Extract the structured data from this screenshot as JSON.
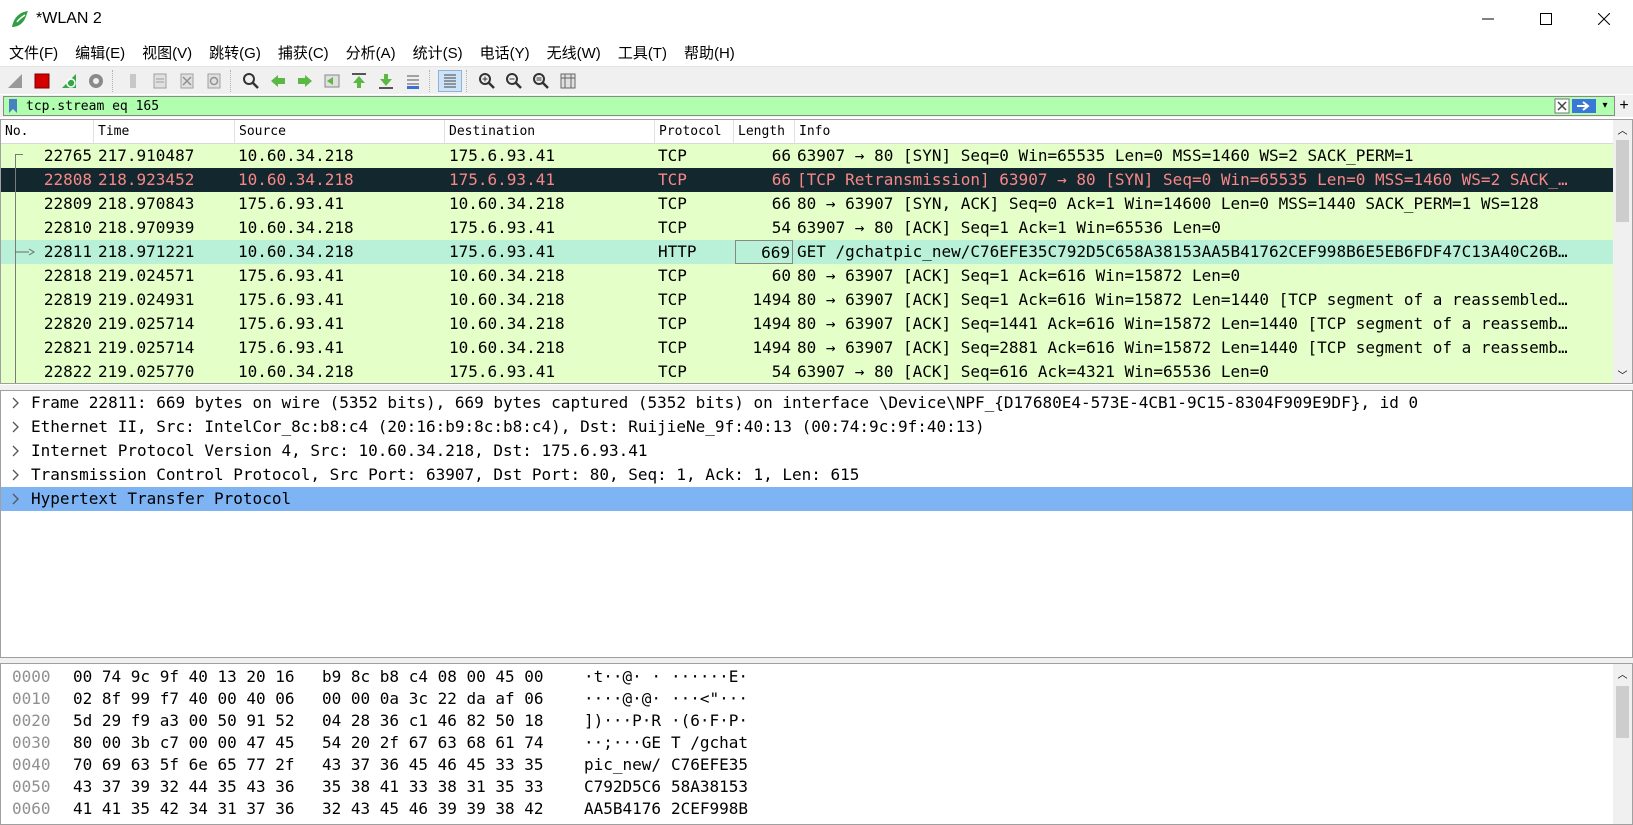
{
  "window": {
    "title": "*WLAN 2",
    "controls": [
      "minimize",
      "maximize",
      "close"
    ]
  },
  "menu": [
    "文件(F)",
    "编辑(E)",
    "视图(V)",
    "跳转(G)",
    "捕获(C)",
    "分析(A)",
    "统计(S)",
    "电话(Y)",
    "无线(W)",
    "工具(T)",
    "帮助(H)"
  ],
  "toolbar_icons": [
    "shark-fin-start-icon",
    "stop-capture-icon",
    "restart-capture-icon",
    "capture-options-icon",
    "open-file-icon",
    "save-file-icon",
    "close-file-icon",
    "reload-file-icon",
    "find-packet-icon",
    "go-back-icon",
    "go-forward-icon",
    "go-to-packet-icon",
    "go-first-icon",
    "go-last-icon",
    "autoscroll-icon",
    "colorize-icon",
    "zoom-in-icon",
    "zoom-out-icon",
    "zoom-normal-icon",
    "resize-columns-icon"
  ],
  "filter": {
    "value": "tcp.stream eq 165",
    "bg_color": "#afffaf"
  },
  "packet_list": {
    "columns": [
      "No.",
      "Time",
      "Source",
      "Destination",
      "Protocol",
      "Length",
      "Info"
    ],
    "rows": [
      {
        "no": "22765",
        "time": "217.910487",
        "src": "10.60.34.218",
        "dst": "175.6.93.41",
        "proto": "TCP",
        "len": "66",
        "info": "63907 → 80 [SYN] Seq=0 Win=65535 Len=0 MSS=1460 WS=2 SACK_PERM=1",
        "style": "row-green"
      },
      {
        "no": "22808",
        "time": "218.923452",
        "src": "10.60.34.218",
        "dst": "175.6.93.41",
        "proto": "TCP",
        "len": "66",
        "info": "[TCP Retransmission] 63907 → 80 [SYN] Seq=0 Win=65535 Len=0 MSS=1460 WS=2 SACK_…",
        "style": "row-black"
      },
      {
        "no": "22809",
        "time": "218.970843",
        "src": "175.6.93.41",
        "dst": "10.60.34.218",
        "proto": "TCP",
        "len": "66",
        "info": "80 → 63907 [SYN, ACK] Seq=0 Ack=1 Win=14600 Len=0 MSS=1440 SACK_PERM=1 WS=128",
        "style": "row-green"
      },
      {
        "no": "22810",
        "time": "218.970939",
        "src": "10.60.34.218",
        "dst": "175.6.93.41",
        "proto": "TCP",
        "len": "54",
        "info": "63907 → 80 [ACK] Seq=1 Ack=1 Win=65536 Len=0",
        "style": "row-green"
      },
      {
        "no": "22811",
        "time": "218.971221",
        "src": "10.60.34.218",
        "dst": "175.6.93.41",
        "proto": "HTTP",
        "len": "669",
        "info": "GET /gchatpic_new/C76EFE35C792D5C658A38153AA5B41762CEF998B6E5EB6FDF47C13A40C26B…",
        "style": "row-sel"
      },
      {
        "no": "22818",
        "time": "219.024571",
        "src": "175.6.93.41",
        "dst": "10.60.34.218",
        "proto": "TCP",
        "len": "60",
        "info": "80 → 63907 [ACK] Seq=1 Ack=616 Win=15872 Len=0",
        "style": "row-green"
      },
      {
        "no": "22819",
        "time": "219.024931",
        "src": "175.6.93.41",
        "dst": "10.60.34.218",
        "proto": "TCP",
        "len": "1494",
        "info": "80 → 63907 [ACK] Seq=1 Ack=616 Win=15872 Len=1440 [TCP segment of a reassembled…",
        "style": "row-green"
      },
      {
        "no": "22820",
        "time": "219.025714",
        "src": "175.6.93.41",
        "dst": "10.60.34.218",
        "proto": "TCP",
        "len": "1494",
        "info": "80 → 63907 [ACK] Seq=1441 Ack=616 Win=15872 Len=1440 [TCP segment of a reassemb…",
        "style": "row-green"
      },
      {
        "no": "22821",
        "time": "219.025714",
        "src": "175.6.93.41",
        "dst": "10.60.34.218",
        "proto": "TCP",
        "len": "1494",
        "info": "80 → 63907 [ACK] Seq=2881 Ack=616 Win=15872 Len=1440 [TCP segment of a reassemb…",
        "style": "row-green"
      },
      {
        "no": "22822",
        "time": "219.025770",
        "src": "10.60.34.218",
        "dst": "175.6.93.41",
        "proto": "TCP",
        "len": "54",
        "info": "63907 → 80 [ACK] Seq=616 Ack=4321 Win=65536 Len=0",
        "style": "row-green"
      }
    ]
  },
  "details": [
    {
      "text": "Frame 22811: 669 bytes on wire (5352 bits), 669 bytes captured (5352 bits) on interface \\Device\\NPF_{D17680E4-573E-4CB1-9C15-8304F909E9DF}, id 0",
      "selected": false
    },
    {
      "text": "Ethernet II, Src: IntelCor_8c:b8:c4 (20:16:b9:8c:b8:c4), Dst: RuijieNe_9f:40:13 (00:74:9c:9f:40:13)",
      "selected": false
    },
    {
      "text": "Internet Protocol Version 4, Src: 10.60.34.218, Dst: 175.6.93.41",
      "selected": false
    },
    {
      "text": "Transmission Control Protocol, Src Port: 63907, Dst Port: 80, Seq: 1, Ack: 1, Len: 615",
      "selected": false
    },
    {
      "text": "Hypertext Transfer Protocol",
      "selected": true
    }
  ],
  "bytes": [
    {
      "off": "0000",
      "hex1": "00 74 9c 9f 40 13 20 16",
      "hex2": "b9 8c b8 c4 08 00 45 00",
      "asc1": "·t··@· ·",
      "asc2": "······E·"
    },
    {
      "off": "0010",
      "hex1": "02 8f 99 f7 40 00 40 06",
      "hex2": "00 00 0a 3c 22 da af 06",
      "asc1": "····@·@·",
      "asc2": "···<\"···"
    },
    {
      "off": "0020",
      "hex1": "5d 29 f9 a3 00 50 91 52",
      "hex2": "04 28 36 c1 46 82 50 18",
      "asc1": "])···P·R",
      "asc2": "·(6·F·P·"
    },
    {
      "off": "0030",
      "hex1": "80 00 3b c7 00 00 47 45",
      "hex2": "54 20 2f 67 63 68 61 74",
      "asc1": "··;···GE",
      "asc2": "T /gchat"
    },
    {
      "off": "0040",
      "hex1": "70 69 63 5f 6e 65 77 2f",
      "hex2": "43 37 36 45 46 45 33 35",
      "asc1": "pic_new/",
      "asc2": "C76EFE35"
    },
    {
      "off": "0050",
      "hex1": "43 37 39 32 44 35 43 36",
      "hex2": "35 38 41 33 38 31 35 33",
      "asc1": "C792D5C6",
      "asc2": "58A38153"
    },
    {
      "off": "0060",
      "hex1": "41 41 35 42 34 31 37 36",
      "hex2": "32 43 45 46 39 39 38 42",
      "asc1": "AA5B4176",
      "asc2": "2CEF998B"
    }
  ]
}
